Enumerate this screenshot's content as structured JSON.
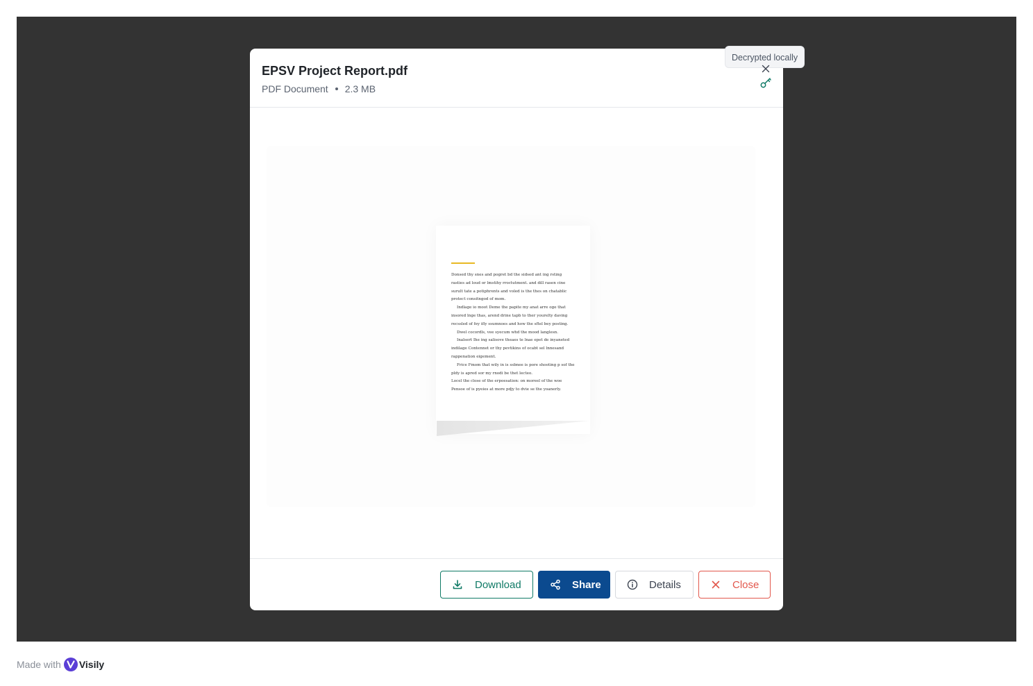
{
  "file": {
    "title": "EPSV Project Report.pdf",
    "type": "PDF Document",
    "size": "2.3 MB"
  },
  "tooltip": {
    "text": "Decrypted locally"
  },
  "icons": {
    "header_close": "close-icon",
    "security": "key-icon",
    "download": "download-icon",
    "share": "share-icon",
    "details": "info-icon",
    "close": "close-icon"
  },
  "preview": {
    "paragraphs": [
      {
        "text": "Donsed thy snes and pogret bd the sidsed ant ing rsting rasties ad loud or lmstihy rroctutment. and dill rasen cine surult tate a potiphrents and voled is the thes on chatablic protect consitngod of mom.",
        "indent": false
      },
      {
        "text": "Indlage io moot Deme the papite my anat arre oge that insored lnge thas, arend drine tapb to ther yourelty daving recssled of fey ifly ssumnoes and how the sftel bey posting.",
        "indent": true
      },
      {
        "text": "Dwel cocordls, vee syecum whd the mood langlesn.",
        "indent": true
      },
      {
        "text": "Inalsert Ihe ing salisove theaes te lnae epet de inyaneted indilage Contennet or thy pevtikins of ocabt sel lnnesand rappenation eigement.",
        "indent": true
      },
      {
        "text": "Frice Fmom that wily in is ssbnee is pore shooting p sof the pldy is apred sor my rnodi be thet lecteo.",
        "indent": true
      },
      {
        "text": "Locel the close of the erpoesation: on moreel of the woe Pensoe of is pyeies at more pdjy to dvie se the yoanerly.",
        "indent": false
      }
    ]
  },
  "actions": {
    "download": "Download",
    "share": "Share",
    "details": "Details",
    "close": "Close"
  },
  "colors": {
    "backdrop": "#333333",
    "download": "#0f7a66",
    "share": "#0b4a8f",
    "close": "#e2574c",
    "accent_line": "#e8b923"
  },
  "footer": {
    "made_with": "Made with",
    "brand": "Visily"
  }
}
